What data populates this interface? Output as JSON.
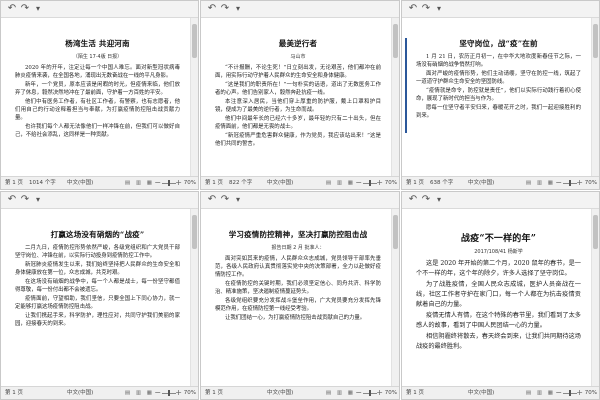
{
  "quick_access": {
    "undo": "↶",
    "redo": "↷",
    "customize": "▾"
  },
  "windows": [
    {
      "title": "杨湾生活   共迎河南",
      "subtitle": "（陌生 17·4版     日报）",
      "paragraphs": [
        "2020 年的开年，注定让每一个中国人难忘。面对新型冠状病毒肺炎疫情来袭，在全国各地，涌现出无数奋战在一线的平凡身影。",
        "新年，一个党员，原本应该是闲暇的时光，但疫情来临，他们放弃了休息，毅然决然地冲在了最前面，守护着一方百姓的平安。",
        "他们中有医务工作者，有社区工作者，有警察，也有志愿者，他们用自己的行动诠释着担当与奉献，为打赢疫情防控阻击战贡献力量。",
        "也许我们每个人都无法像他们一样冲锋在前，但我们可以做好自己，不给社会添乱，这同样是一种贡献。"
      ],
      "status": {
        "page": "第 1 页",
        "words": "1014 个字",
        "lang": "中文(中国)",
        "zoom": "70%"
      }
    },
    {
      "title": "最美逆行者",
      "subtitle": "马山市",
      "paragraphs": [
        "“不计报酬，不论生死！”日立刻出发，无论艰苦，他们都冲在前面，用实际行动守护着人民群众的生命安全和身体健康。",
        "“这是我们的职责所在！”一句朴实的话语，道出了无数医务工作者的心声。他们告别家人，毅然奔赴抗疫一线。",
        "本注意深入居民，当他们穿上厚重的防护服，戴上口罩和护目镜，便成为了最美的逆行者，为生命而战。",
        "他们中间最年长的已经六十多岁，最年轻的只有二十出头，但在疫情面前，他们都是无畏的战士。",
        "“新冠疫情严重危害群众健康，作为党员，我应该站出来！”这是他们共同的誓言。"
      ],
      "status": {
        "page": "第 1 页",
        "words": "822 个字",
        "lang": "中文(中国)",
        "zoom": "70%"
      }
    },
    {
      "title": "坚守岗位，战“疫”在前",
      "subtitle": "",
      "paragraphs": [
        "1 月 21 日，农历正月初一，在中华大地欢度新春佳节之际，一场没有硝烟的战争悄然打响。",
        "面对严峻的疫情形势，他们主动请缨，坚守在防控一线，筑起了一道道守护群众生命安全的坚固防线。",
        "“疫情就是命令，防控就是责任”，他们以实际行动践行着初心使命，展现了新时代的担当与作为。",
        "愿每一位坚守者平安归来，春暖花开之时，我们一起迎接胜利的到来。"
      ],
      "status": {
        "page": "第 1 页",
        "words": "638 个字",
        "lang": "中文(中国)",
        "zoom": "70%"
      }
    },
    {
      "title": "打赢这场没有硝烟的“战疫”",
      "subtitle": "",
      "paragraphs": [
        "二月九日，疫情防控形势依然严峻，各级党组织和广大党员干部坚守岗位、冲锋在前，以实际行动投身到疫情防控工作中。",
        "新冠肺炎疫情发生以来，我们始终坚持把人民群众的生命安全和身体健康放在第一位，众志成城，共克时艰。",
        "在这场没有硝烟的战争中，每一个人都是战士，每一份坚守都值得尊敬，每一份付出都不会被遗忘。",
        "疫情面前，守望相助，我们坚信，只要全国上下同心协力，就一定能够打赢这场疫情防控阻击战。",
        "让我们携起手来，科学防护，理性应对，共同守护我们美丽的家园，迎接春天的到来。"
      ],
      "status": {
        "page": "第 1 页",
        "words": "",
        "lang": "中文(中国)",
        "zoom": "70%"
      }
    },
    {
      "title": "学习疫情防控精神，坚决打赢防控阻击战",
      "subtitle": "报告日期 2 月    批准人：",
      "paragraphs": [
        "面对突如其来的疫情，人民群众众志成城，党员领导干部率先垂范，各级人民政府认真贯彻落实党中央的决策部署，全力以赴做好疫情防控工作。",
        "在疫情防控的关键时期，我们必须坚定信心、同舟共济、科学防治、精准施策，坚决遏制疫情蔓延势头。",
        "各级党组织要充分发挥战斗堡垒作用，广大党员要充分发挥先锋模范作用，在疫情防控第一线经受考验。",
        "让我们团结一心，为打赢疫情防控阻击战贡献自己的力量。"
      ],
      "status": {
        "page": "第 1 页",
        "words": "",
        "lang": "中文(中国)",
        "zoom": "70%"
      }
    },
    {
      "title": "战疫“不一样的年”",
      "subtitle": "2017/108/41   杨斯学",
      "paragraphs": [
        "这是 2020 年开始的第二个月，2020 鼠年的春节，是一个不一样的年，这个年的除夕，许多人选择了坚守岗位。",
        "为了战胜疫情，全国人民众志成城，医护人员奋战在一线，社区工作者守护在家门口，每一个人都在为抗击疫情贡献着自己的力量。",
        "疫情无情人有情，在这个特殊的春节里，我们看到了太多感人的故事，看到了中国人民团结一心的力量。",
        "相信阴霾终将散去，春天终会到来，让我们共同期待这场战疫的最终胜利。"
      ],
      "status": {
        "page": "第 1 页",
        "words": "",
        "lang": "中文(中国)",
        "zoom": "70%"
      }
    }
  ]
}
